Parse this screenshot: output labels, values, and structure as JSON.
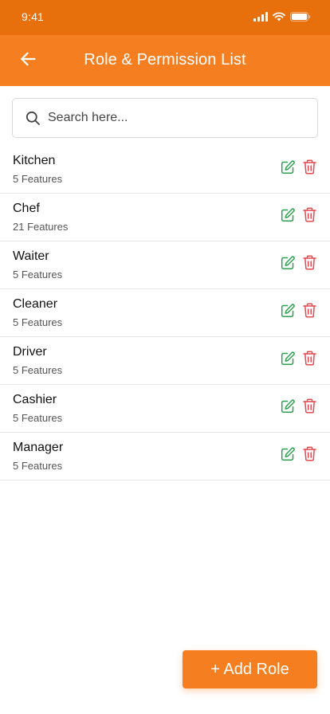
{
  "status_bar": {
    "time": "9:41",
    "icons": [
      "signal-icon",
      "wifi-icon",
      "battery-icon"
    ]
  },
  "app_bar": {
    "title": "Role & Permission List",
    "back_icon": "arrow-left-icon"
  },
  "search": {
    "placeholder": "Search here...",
    "value": ""
  },
  "roles": [
    {
      "name": "Kitchen",
      "features": "5 Features"
    },
    {
      "name": "Chef",
      "features": "21 Features"
    },
    {
      "name": "Waiter",
      "features": "5 Features"
    },
    {
      "name": "Cleaner",
      "features": "5 Features"
    },
    {
      "name": "Driver",
      "features": "5 Features"
    },
    {
      "name": "Cashier",
      "features": "5 Features"
    },
    {
      "name": "Manager",
      "features": "5 Features"
    }
  ],
  "actions": {
    "add_role_label": "+ Add Role"
  },
  "colors": {
    "primary": "#F57F20",
    "status_bar": "#E8700C",
    "edit": "#2E9E4F",
    "delete": "#E5484D"
  }
}
